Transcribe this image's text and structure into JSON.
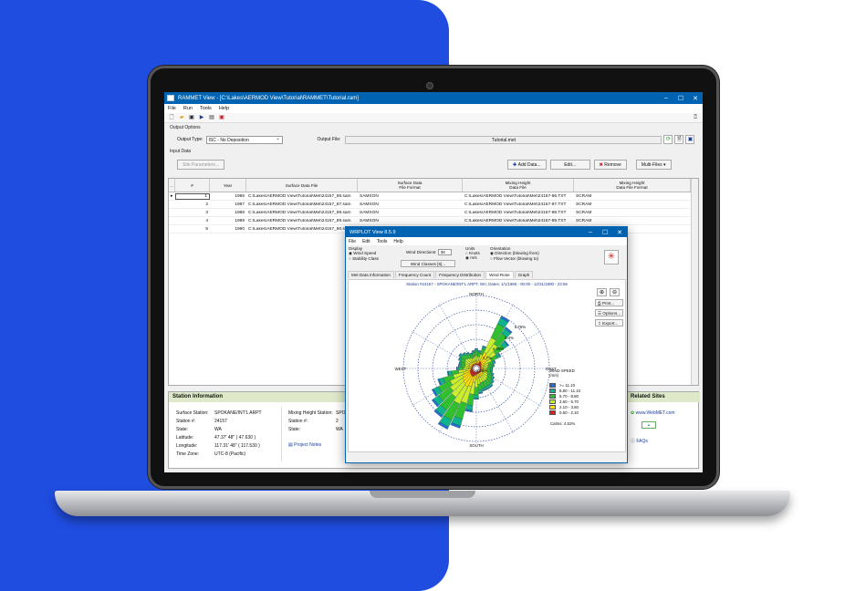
{
  "main": {
    "title": "RAMMET View - [C:\\Lakes\\AERMOD View\\Tutorial\\RAMMET\\Tutorial.ram]",
    "menu": [
      "File",
      "Run",
      "Tools",
      "Help"
    ],
    "output_options_label": "Output Options",
    "output_type_label": "Output Type:",
    "output_type_value": "ISC - No Deposition",
    "output_file_label": "Output File:",
    "output_file_value": "Tutorial.met",
    "input_data_label": "Input Data",
    "site_params_btn": "Site Parameters...",
    "add_data_btn": "Add Data...",
    "edit_btn": "Edit...",
    "remove_btn": "Remove",
    "multi_files_btn": "Multi-Files",
    "columns": [
      "#",
      "Year",
      "Surface Data File",
      "Surface Data\nFile Format",
      "Mixing Height\nData File",
      "Mixing Height\nData File Format"
    ],
    "rows": [
      [
        "1",
        "1986",
        "C:\\Lakes\\AERMOD View\\Tutorial\\Met\\24157_86.sam",
        "SAMSON",
        "C:\\Lakes\\AERMOD View\\Tutorial\\Met\\24157-86.TXT",
        "SCRAM"
      ],
      [
        "2",
        "1987",
        "C:\\Lakes\\AERMOD View\\Tutorial\\Met\\24157_87.sam",
        "SAMSON",
        "C:\\Lakes\\AERMOD View\\Tutorial\\Met\\24157-87.TXT",
        "SCRAM"
      ],
      [
        "3",
        "1988",
        "C:\\Lakes\\AERMOD View\\Tutorial\\Met\\24157_88.sam",
        "SAMSON",
        "C:\\Lakes\\AERMOD View\\Tutorial\\Met\\24157-88.TXT",
        "SCRAM"
      ],
      [
        "4",
        "1989",
        "C:\\Lakes\\AERMOD View\\Tutorial\\Met\\24157_89.sam",
        "SAMSON",
        "C:\\Lakes\\AERMOD View\\Tutorial\\Met\\24157-89.TXT",
        "SCRAM"
      ],
      [
        "5",
        "1990",
        "C:\\Lakes\\AERMOD View\\Tutorial\\Met\\24157_90.sam",
        "SAMSON",
        "C:\\Lakes\\AERMOD View\\Tutorial\\Met\\24157-90.TXT",
        "SCRAM"
      ]
    ],
    "station_info_title": "Station Information",
    "surface_station_label": "Surface Station:",
    "surface_station_value": "SPOKANE/INT'L ARPT",
    "station_no_label": "Station #:",
    "station_no_value": "24157",
    "state_label": "State:",
    "state_value": "WA",
    "latitude_label": "Latitude:",
    "latitude_value": "47.37' 48\"  ( 47.630 )",
    "longitude_label": "Longitude:",
    "longitude_value": "117.31' 48\"  ( 117.530 )",
    "timezone_label": "Time Zone:",
    "timezone_value": "UTC-8 (Pacific)",
    "mixing_station_label": "Mixing Height Station:",
    "mixing_station_value": "SPO",
    "mixing_station_no_value": "2",
    "mixing_state_value": "WA",
    "project_notes": "Project Notes",
    "related_sites_title": "Related Sites",
    "related_sites": [
      "www.WebMET.com",
      "FAQs"
    ]
  },
  "wrplot": {
    "title": "WRPLOT View 8.5.9",
    "menu": [
      "File",
      "Edit",
      "Tools",
      "Help"
    ],
    "display_label": "Display",
    "display_options": [
      "Wind Speed",
      "Stability Class"
    ],
    "wind_dir_label": "Wind Directions:",
    "wind_dir_value": "36",
    "wind_classes_btn": "Wind Classes [6]...",
    "units_label": "Units",
    "units": [
      "Knots",
      "m/s"
    ],
    "orientation_label": "Orientation",
    "orientation_options": [
      "Direction (blowing from)",
      "Flow Vector (blowing to)"
    ],
    "tabs": [
      "Met Data Information",
      "Frequency Count",
      "Frequency Distribution",
      "Wind Rose",
      "Graph"
    ],
    "header": "Station #24157 - SPOKANE/INT'L ARPT, WA; Dates: 1/1/1986 - 00:00 - 12/31/1990 - 23:59",
    "compass": {
      "n": "NORTH",
      "s": "SOUTH",
      "e": "EAST",
      "w": "WEST"
    },
    "ring_labels": [
      "6.75%",
      "5.4%",
      "4.05%",
      "2.7%",
      "1.35%"
    ],
    "side_buttons": [
      "Print...",
      "Options...",
      "Export..."
    ],
    "legend_title": "WIND SPEED\n(m/s)",
    "legend": [
      {
        "label": ">= 11.10",
        "color": "#1f6fd6"
      },
      {
        "label": "8.80 - 11.10",
        "color": "#0db38c"
      },
      {
        "label": "5.70 - 8.80",
        "color": "#2fbf2f"
      },
      {
        "label": "3.60 - 5.70",
        "color": "#c9ee2a"
      },
      {
        "label": "2.10 - 3.60",
        "color": "#ffe000"
      },
      {
        "label": "0.50 - 2.10",
        "color": "#e21b1b"
      }
    ],
    "calms": "Calms: 4.52%"
  }
}
